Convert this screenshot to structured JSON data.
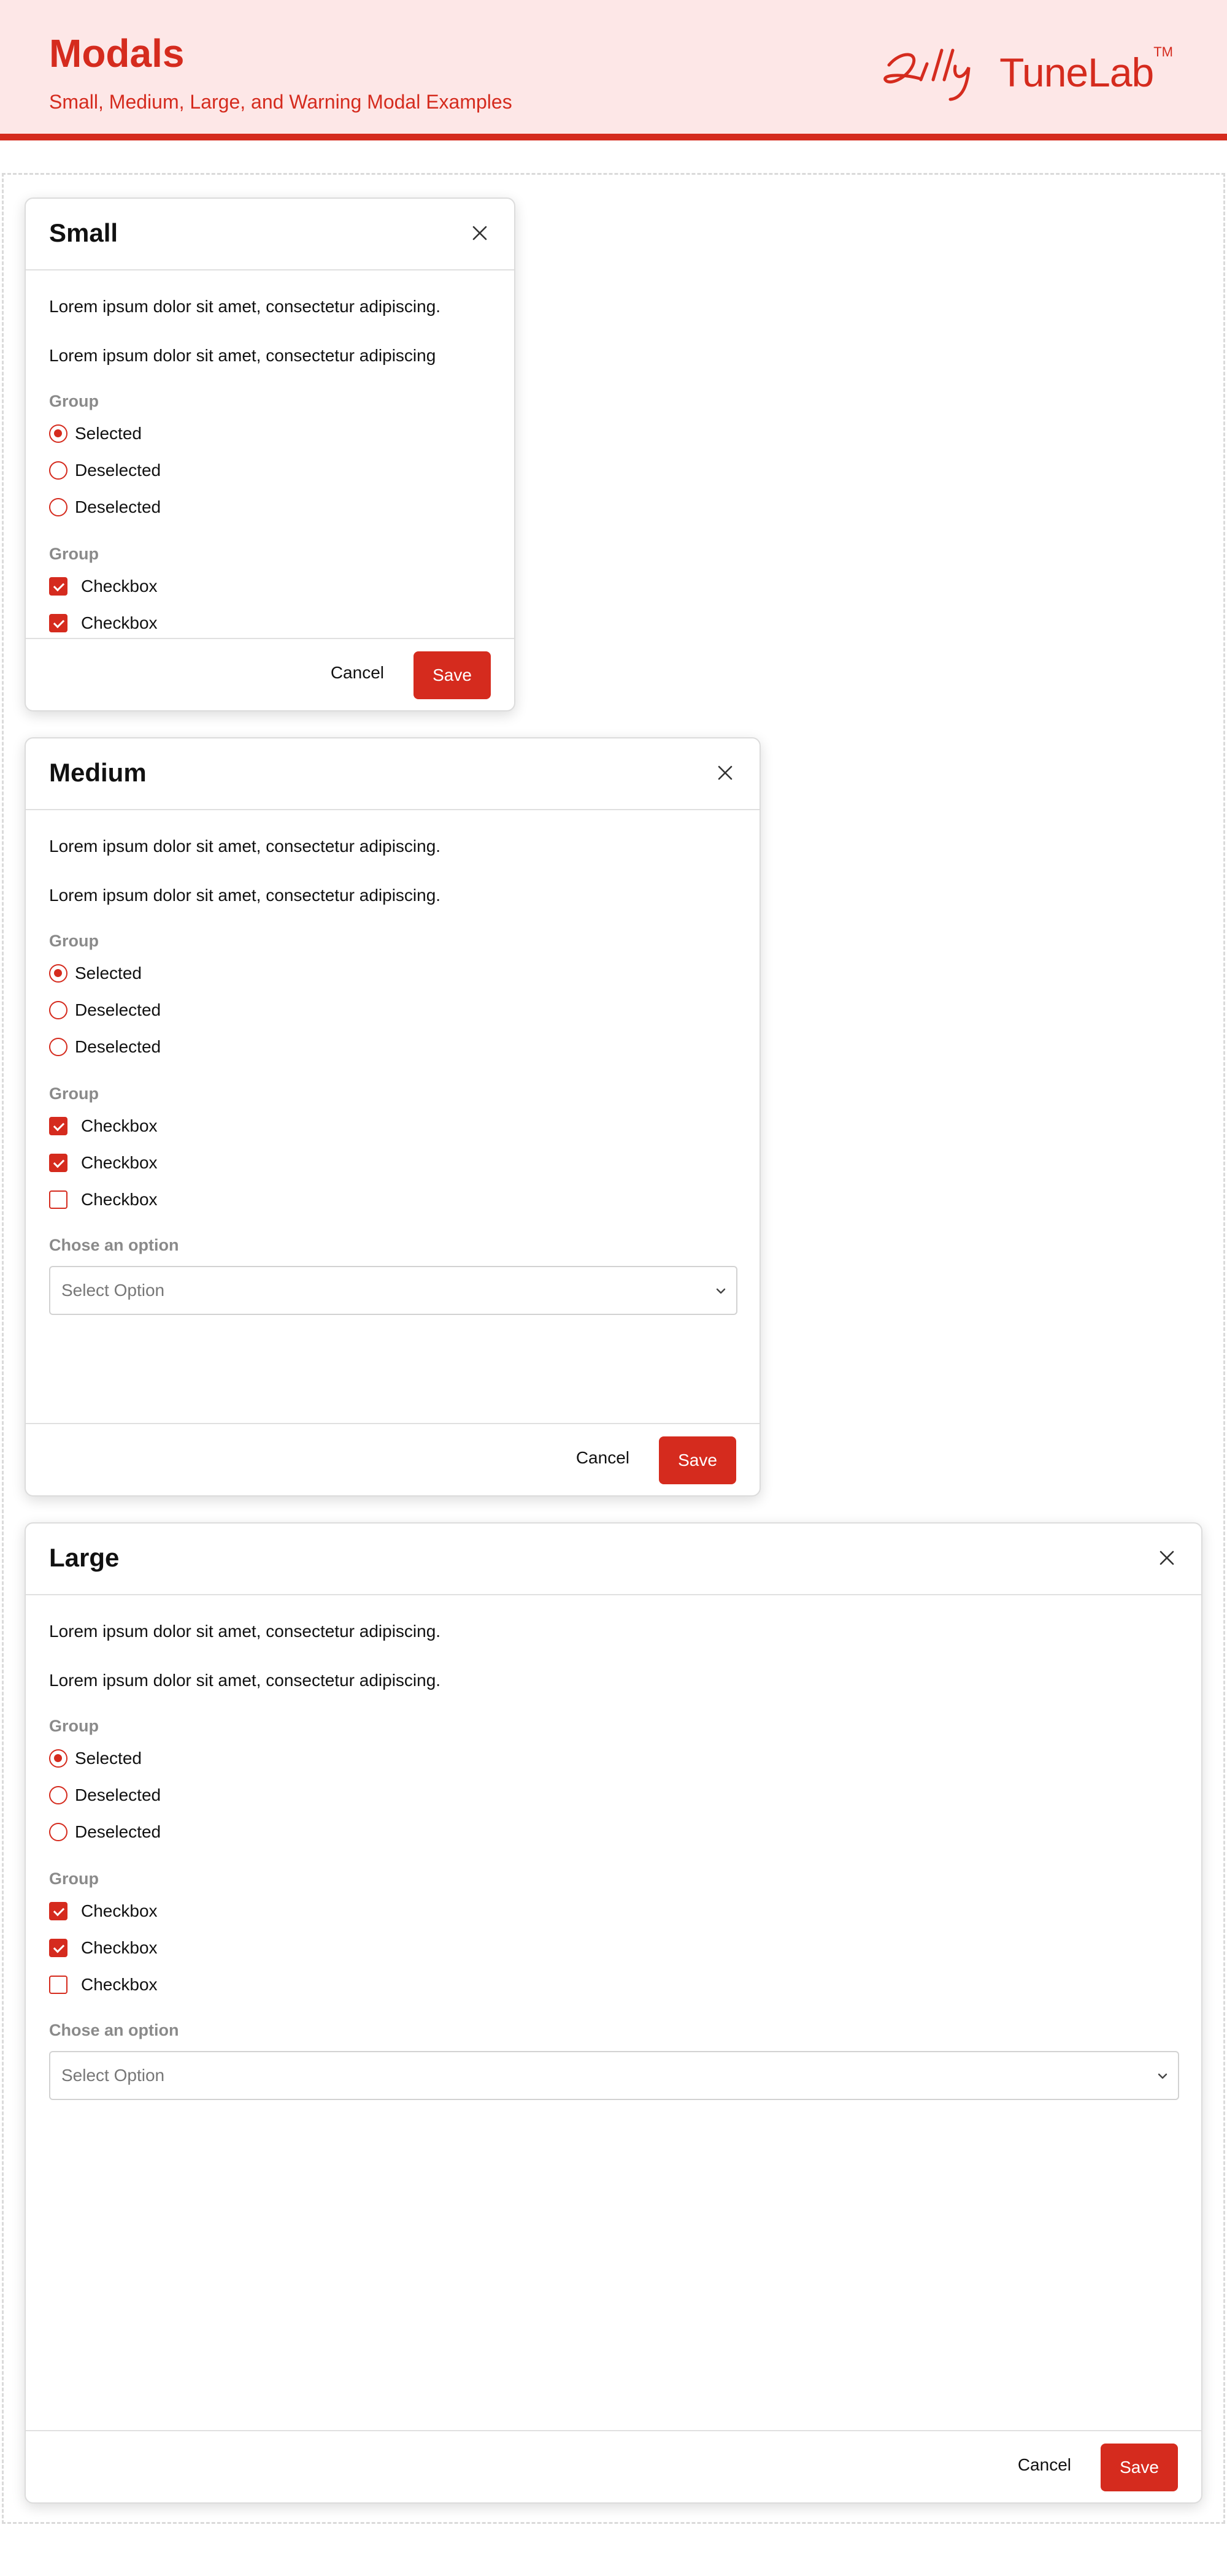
{
  "header": {
    "title": "Modals",
    "subtitle": "Small, Medium, Large, and Warning Modal Examples",
    "brand_script": "Lilly",
    "brand_name": "TuneLab",
    "brand_tm": "TM"
  },
  "colors": {
    "accent": "#d52b1e",
    "header_bg": "#fde7e7",
    "label_gray": "#8a8a8a"
  },
  "modals": {
    "small": {
      "title": "Small",
      "para1": "Lorem ipsum dolor sit amet, consectetur adipiscing.",
      "para2": "Lorem ipsum dolor sit amet, consectetur adipiscing",
      "radio_group_label": "Group",
      "radios": [
        {
          "label": "Selected",
          "checked": true
        },
        {
          "label": "Deselected",
          "checked": false
        },
        {
          "label": "Deselected",
          "checked": false
        }
      ],
      "checkbox_group_label": "Group",
      "checkboxes": [
        {
          "label": "Checkbox",
          "checked": true
        },
        {
          "label": "Checkbox",
          "checked": true
        }
      ],
      "cancel": "Cancel",
      "save": "Save"
    },
    "medium": {
      "title": "Medium",
      "para1": "Lorem ipsum dolor sit amet, consectetur adipiscing.",
      "para2": "Lorem ipsum dolor sit amet, consectetur adipiscing.",
      "radio_group_label": "Group",
      "radios": [
        {
          "label": "Selected",
          "checked": true
        },
        {
          "label": "Deselected",
          "checked": false
        },
        {
          "label": "Deselected",
          "checked": false
        }
      ],
      "checkbox_group_label": "Group",
      "checkboxes": [
        {
          "label": "Checkbox",
          "checked": true
        },
        {
          "label": "Checkbox",
          "checked": true
        },
        {
          "label": "Checkbox",
          "checked": false
        }
      ],
      "select_label": "Chose an option",
      "select_placeholder": "Select Option",
      "cancel": "Cancel",
      "save": "Save"
    },
    "large": {
      "title": "Large",
      "para1": "Lorem ipsum dolor sit amet, consectetur adipiscing.",
      "para2": "Lorem ipsum dolor sit amet, consectetur adipiscing.",
      "radio_group_label": "Group",
      "radios": [
        {
          "label": "Selected",
          "checked": true
        },
        {
          "label": "Deselected",
          "checked": false
        },
        {
          "label": "Deselected",
          "checked": false
        }
      ],
      "checkbox_group_label": "Group",
      "checkboxes": [
        {
          "label": "Checkbox",
          "checked": true
        },
        {
          "label": "Checkbox",
          "checked": true
        },
        {
          "label": "Checkbox",
          "checked": false
        }
      ],
      "select_label": "Chose an option",
      "select_placeholder": "Select Option",
      "cancel": "Cancel",
      "save": "Save"
    }
  }
}
